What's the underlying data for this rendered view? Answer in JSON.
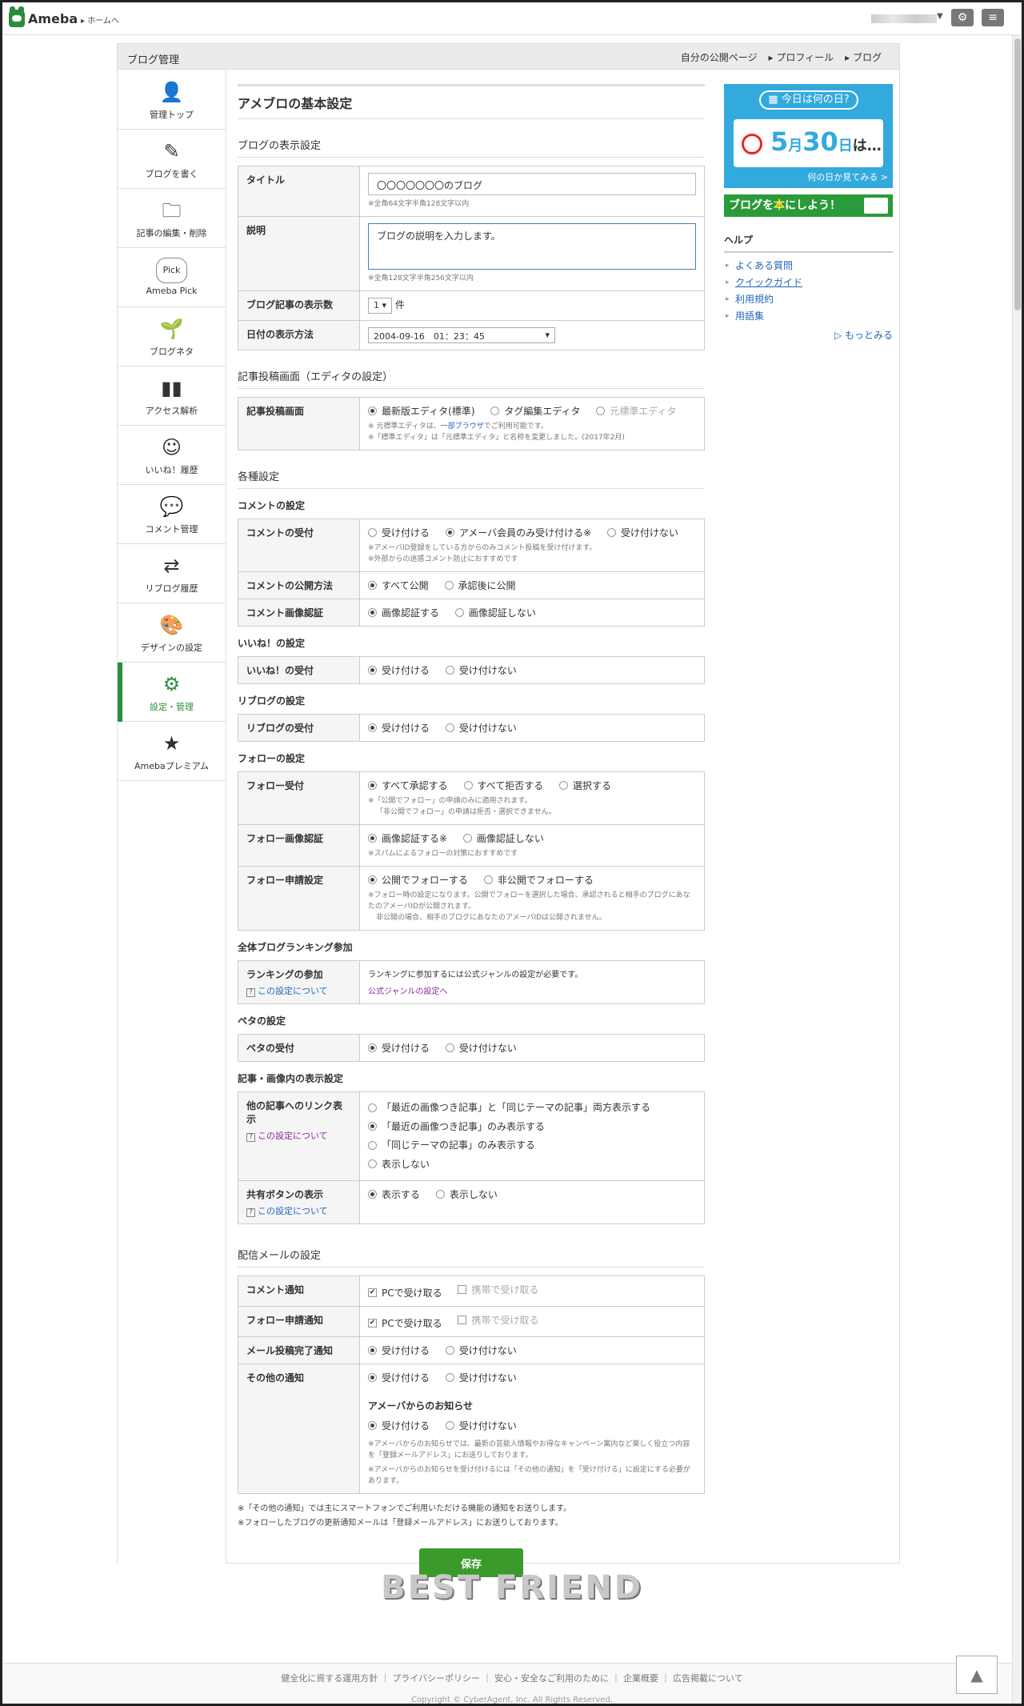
{
  "header": {
    "brand": "Ameba",
    "home_link": "ホームへ",
    "user_arrow": "▼",
    "settings_icon": "gear-icon",
    "menu_icon": "menu-icon"
  },
  "manage_bar": {
    "title": "ブログ管理",
    "links": [
      "自分の公開ページ",
      "プロフィール",
      "ブログ"
    ]
  },
  "sidebar": {
    "items": [
      {
        "label": "管理トップ",
        "icon": "user-icon"
      },
      {
        "label": "ブログを書く",
        "icon": "pencil-icon"
      },
      {
        "label": "記事の編集・削除",
        "icon": "folder-icon"
      },
      {
        "label": "Ameba Pick",
        "icon": "pick-icon",
        "pick": "Pick"
      },
      {
        "label": "ブログネタ",
        "icon": "sprout-icon"
      },
      {
        "label": "アクセス解析",
        "icon": "bar-chart-icon"
      },
      {
        "label": "いいね！履歴",
        "icon": "smile-icon"
      },
      {
        "label": "コメント管理",
        "icon": "comment-icon"
      },
      {
        "label": "リブログ履歴",
        "icon": "reblog-icon"
      },
      {
        "label": "デザインの設定",
        "icon": "palette-icon"
      },
      {
        "label": "設定・管理",
        "icon": "gear-icon",
        "active": true
      },
      {
        "label": "Amebaプレミアム",
        "icon": "premium-badge-icon"
      }
    ]
  },
  "main": {
    "page_title": "アメブロの基本設定",
    "display": {
      "heading": "ブログの表示設定",
      "title_label": "タイトル",
      "title_value": "〇〇〇〇〇〇〇のブログ",
      "title_note": "※全角64文字半角128文字以内",
      "desc_label": "説明",
      "desc_value": "ブログの説明を入力します。",
      "desc_note": "※全角128文字半角256文字以内",
      "count_label": "ブログ記事の表示数",
      "count_value": "1",
      "count_unit": "件",
      "date_label": "日付の表示方法",
      "date_value": "2004-09-16　01：23：45"
    },
    "editor": {
      "heading": "記事投稿画面（エディタの設定）",
      "label": "記事投稿画面",
      "opt1": "最新版エディタ(標準)",
      "opt2": "タグ編集エディタ",
      "opt3": "元標準エディタ",
      "note1_pre": "※ 元標準エディタは、",
      "note1_link": "一部ブラウザ",
      "note1_post": "でご利用可能です。",
      "note2": "※「標準エディタ」は「元標準エディタ」と名称を変更しました。(2017年2月)"
    },
    "various": {
      "heading": "各種設定",
      "comment_sub": "コメントの設定",
      "c_accept_label": "コメントの受付",
      "c_accept_opts": [
        "受け付ける",
        "アメーバ会員のみ受け付ける※",
        "受け付けない"
      ],
      "c_accept_note1": "※アメーバID登録をしている方からのみコメント投稿を受け付けます。",
      "c_accept_note2": "※外部からの迷惑コメント防止におすすめです",
      "c_publish_label": "コメントの公開方法",
      "c_publish_opts": [
        "すべて公開",
        "承認後に公開"
      ],
      "c_captcha_label": "コメント画像認証",
      "c_captcha_opts": [
        "画像認証する",
        "画像認証しない"
      ],
      "like_sub": "いいね！の設定",
      "like_label": "いいね！の受付",
      "like_opts": [
        "受け付ける",
        "受け付けない"
      ],
      "reblog_sub": "リブログの設定",
      "reblog_label": "リブログの受付",
      "reblog_opts": [
        "受け付ける",
        "受け付けない"
      ],
      "follow_sub": "フォローの設定",
      "f_accept_label": "フォロー受付",
      "f_accept_opts": [
        "すべて承認する",
        "すべて拒否する",
        "選択する"
      ],
      "f_accept_note1": "※「公開でフォロー」の申請のみに適用されます。",
      "f_accept_note2": "「非公開でフォロー」の申請は拒否・選択できません。",
      "f_captcha_label": "フォロー画像認証",
      "f_captcha_opts": [
        "画像認証する※",
        "画像認証しない"
      ],
      "f_captcha_note": "※スパムによるフォローの対策におすすめです",
      "f_request_label": "フォロー申請設定",
      "f_request_opts": [
        "公開でフォローする",
        "非公開でフォローする"
      ],
      "f_request_note1": "※フォロー時の設定になります。公開でフォローを選択した場合、承認されると相手のブログにあなたのアメーバIDが公開されます。",
      "f_request_note2": "非公開の場合、相手のブログにあなたのアメーバIDは公開されません。",
      "ranking_sub": "全体ブログランキング参加",
      "ranking_label": "ランキングの参加",
      "about_setting": "この設定について",
      "ranking_text": "ランキングに参加するには公式ジャンルの設定が必要です。",
      "ranking_link": "公式ジャンルの設定へ",
      "peta_sub": "ペタの設定",
      "peta_label": "ペタの受付",
      "peta_opts": [
        "受け付ける",
        "受け付けない"
      ],
      "article_sub": "記事・画像内の表示設定",
      "link_label": "他の記事へのリンク表示",
      "link_opts": [
        "「最近の画像つき記事」と「同じテーマの記事」両方表示する",
        "「最近の画像つき記事」のみ表示する",
        "「同じテーマの記事」のみ表示する",
        "表示しない"
      ],
      "share_label": "共有ボタンの表示",
      "share_opts": [
        "表示する",
        "表示しない"
      ]
    },
    "mail": {
      "heading": "配信メールの設定",
      "comment_label": "コメント通知",
      "follow_label": "フォロー申請通知",
      "pc": "PCで受け取る",
      "mobile": "携帯で受け取る",
      "post_label": "メール投稿完了通知",
      "post_opts": [
        "受け付ける",
        "受け付けない"
      ],
      "other_label": "その他の通知",
      "other_opts": [
        "受け付ける",
        "受け付けない"
      ],
      "news_title": "アメーバからのお知らせ",
      "news_opts": [
        "受け付ける",
        "受け付けない"
      ],
      "news_note1": "※アメーバからのお知らせでは、最新の芸能人情報やお得なキャンペーン案内など楽しく役立つ内容を「登録メールアドレス」にお送りしております。",
      "news_note2": "※アメーバからのお知らせを受け付けるには「その他の通知」を「受け付ける」に設定にする必要があります。"
    },
    "footnote1": "※「その他の通知」では主にスマートフォンでご利用いただける機能の通知をお送りします。",
    "footnote2": "※フォローしたブログの更新通知メールは「登録メールアドレス」にお送りしております。",
    "save": "保存"
  },
  "right": {
    "today_header": "今日は何の日?",
    "today_month": "5",
    "today_month_unit": "月",
    "today_day": "30",
    "today_day_unit": "日",
    "today_suffix": "は…",
    "today_link": "何の日か見てみる >",
    "book_pre": "ブログを",
    "book_mid": "本",
    "book_post": "にしよう！",
    "help_heading": "ヘルプ",
    "help_links": [
      "よくある質問",
      "クイックガイド",
      "利用規約",
      "用語集"
    ],
    "help_more": "もっとみる"
  },
  "watermark": "BEST FRIEND",
  "footer": {
    "links": [
      "健全化に資する運用方針",
      "プライバシーポリシー",
      "安心・安全なご利用のために",
      "企業概要",
      "広告掲載について"
    ],
    "copyright": "Copyright © CyberAgent, Inc. All Rights Reserved."
  }
}
